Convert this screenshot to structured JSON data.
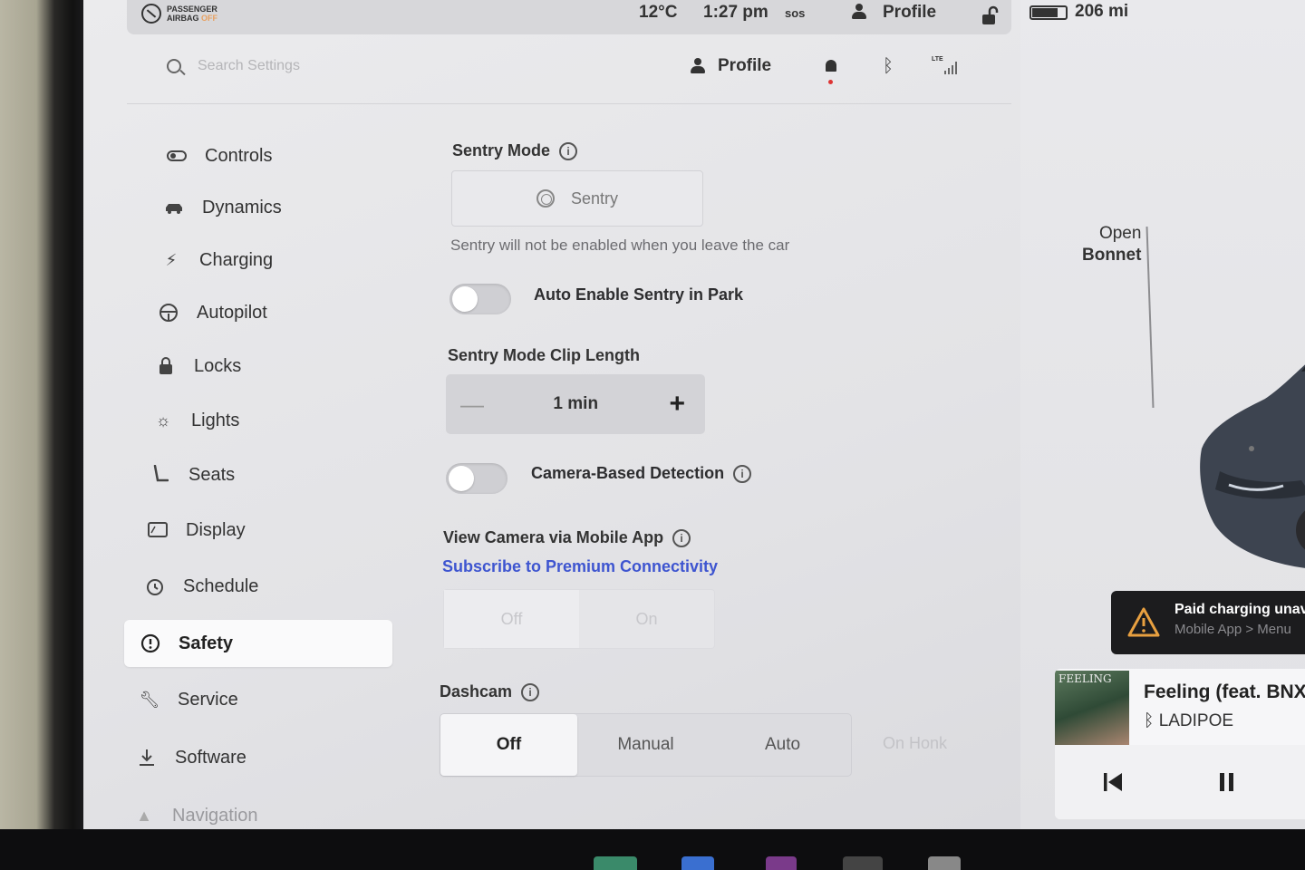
{
  "statusbar": {
    "airbag_line1": "PASSENGER",
    "airbag_line2": "AIRBAG",
    "airbag_state": "OFF",
    "temperature": "12°C",
    "time": "1:27 pm",
    "sos": "sos",
    "profile": "Profile",
    "range": "206 mi"
  },
  "header": {
    "search_placeholder": "Search Settings",
    "profile": "Profile"
  },
  "sidebar": {
    "items": [
      {
        "label": "Controls",
        "icon": "toggle-icon"
      },
      {
        "label": "Dynamics",
        "icon": "car-icon"
      },
      {
        "label": "Charging",
        "icon": "bolt-icon"
      },
      {
        "label": "Autopilot",
        "icon": "steering-wheel-icon"
      },
      {
        "label": "Locks",
        "icon": "lock-icon"
      },
      {
        "label": "Lights",
        "icon": "sun-icon"
      },
      {
        "label": "Seats",
        "icon": "seat-icon"
      },
      {
        "label": "Display",
        "icon": "display-icon"
      },
      {
        "label": "Schedule",
        "icon": "alarm-clock-icon"
      },
      {
        "label": "Safety",
        "icon": "alert-circle-icon",
        "active": true
      },
      {
        "label": "Service",
        "icon": "wrench-icon"
      },
      {
        "label": "Software",
        "icon": "download-icon"
      },
      {
        "label": "Navigation",
        "icon": "navigation-icon"
      }
    ]
  },
  "safety": {
    "sentry_mode_label": "Sentry Mode",
    "sentry_button": "Sentry",
    "sentry_helper": "Sentry will not be enabled when you leave the car",
    "auto_enable_label": "Auto Enable Sentry in Park",
    "auto_enable_on": false,
    "clip_length_label": "Sentry Mode Clip Length",
    "clip_length_value": "1 min",
    "clip_minus": "—",
    "clip_plus": "+",
    "camera_detection_label": "Camera-Based Detection",
    "camera_detection_on": false,
    "view_camera_label": "View Camera via Mobile App",
    "premium_link": "Subscribe to Premium Connectivity",
    "view_camera_options": [
      "Off",
      "On"
    ],
    "dashcam_label": "Dashcam",
    "dashcam_options": [
      "Off",
      "Manual",
      "Auto"
    ],
    "dashcam_selected": "Off",
    "dashcam_extra": "On Honk"
  },
  "car_panel": {
    "bonnet_line1": "Open",
    "bonnet_line2": "Bonnet",
    "alert_title": "Paid charging unav",
    "alert_sub": "Mobile App > Menu"
  },
  "media": {
    "album_text": "FEELING",
    "track": "Feeling (feat. BNX",
    "artist": "LADIPOE"
  },
  "colors": {
    "link": "#3e55d0",
    "alert_bg": "#1c1c1e",
    "warning": "#e8a040",
    "notification_dot": "#dd3333"
  }
}
